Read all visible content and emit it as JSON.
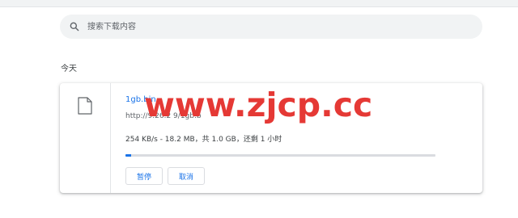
{
  "search": {
    "placeholder": "搜索下载内容",
    "icon": "search-icon"
  },
  "date_heading": "今天",
  "download": {
    "file_name": "1gb.bin",
    "url": "http://9.26.2 9/1gb.b",
    "status": "254 KB/s - 18.2 MB，共 1.0 GB，还剩 1 小时",
    "progress_fraction": 0.018,
    "pause_label": "暂停",
    "cancel_label": "取消",
    "file_icon": "file-icon"
  },
  "watermark": "www.zjcp.cc",
  "colors": {
    "accent": "#1a73e8",
    "watermark": "#e53935",
    "search_bg": "#f1f3f4"
  }
}
